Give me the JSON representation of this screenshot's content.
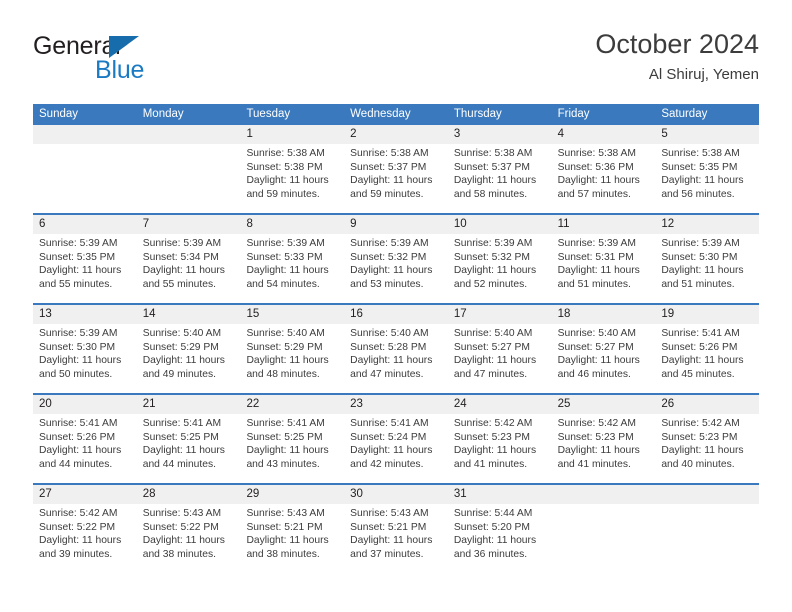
{
  "brand": {
    "name_top": "General",
    "name_bottom": "Blue",
    "accent_color": "#176dab",
    "blue_text_color": "#1b7ac4"
  },
  "header": {
    "title": "October 2024",
    "subtitle": "Al Shiruj, Yemen"
  },
  "theme": {
    "header_row_bg": "#3a79bd",
    "daynum_band_bg": "#f0f0f0",
    "row_divider": "#3a79bd",
    "text": "#3c3c3c"
  },
  "weekdays": [
    "Sunday",
    "Monday",
    "Tuesday",
    "Wednesday",
    "Thursday",
    "Friday",
    "Saturday"
  ],
  "weeks": [
    [
      {
        "day": "",
        "lines": []
      },
      {
        "day": "",
        "lines": []
      },
      {
        "day": "1",
        "lines": [
          "Sunrise: 5:38 AM",
          "Sunset: 5:38 PM",
          "Daylight: 11 hours",
          "and 59 minutes."
        ]
      },
      {
        "day": "2",
        "lines": [
          "Sunrise: 5:38 AM",
          "Sunset: 5:37 PM",
          "Daylight: 11 hours",
          "and 59 minutes."
        ]
      },
      {
        "day": "3",
        "lines": [
          "Sunrise: 5:38 AM",
          "Sunset: 5:37 PM",
          "Daylight: 11 hours",
          "and 58 minutes."
        ]
      },
      {
        "day": "4",
        "lines": [
          "Sunrise: 5:38 AM",
          "Sunset: 5:36 PM",
          "Daylight: 11 hours",
          "and 57 minutes."
        ]
      },
      {
        "day": "5",
        "lines": [
          "Sunrise: 5:38 AM",
          "Sunset: 5:35 PM",
          "Daylight: 11 hours",
          "and 56 minutes."
        ]
      }
    ],
    [
      {
        "day": "6",
        "lines": [
          "Sunrise: 5:39 AM",
          "Sunset: 5:35 PM",
          "Daylight: 11 hours",
          "and 55 minutes."
        ]
      },
      {
        "day": "7",
        "lines": [
          "Sunrise: 5:39 AM",
          "Sunset: 5:34 PM",
          "Daylight: 11 hours",
          "and 55 minutes."
        ]
      },
      {
        "day": "8",
        "lines": [
          "Sunrise: 5:39 AM",
          "Sunset: 5:33 PM",
          "Daylight: 11 hours",
          "and 54 minutes."
        ]
      },
      {
        "day": "9",
        "lines": [
          "Sunrise: 5:39 AM",
          "Sunset: 5:32 PM",
          "Daylight: 11 hours",
          "and 53 minutes."
        ]
      },
      {
        "day": "10",
        "lines": [
          "Sunrise: 5:39 AM",
          "Sunset: 5:32 PM",
          "Daylight: 11 hours",
          "and 52 minutes."
        ]
      },
      {
        "day": "11",
        "lines": [
          "Sunrise: 5:39 AM",
          "Sunset: 5:31 PM",
          "Daylight: 11 hours",
          "and 51 minutes."
        ]
      },
      {
        "day": "12",
        "lines": [
          "Sunrise: 5:39 AM",
          "Sunset: 5:30 PM",
          "Daylight: 11 hours",
          "and 51 minutes."
        ]
      }
    ],
    [
      {
        "day": "13",
        "lines": [
          "Sunrise: 5:39 AM",
          "Sunset: 5:30 PM",
          "Daylight: 11 hours",
          "and 50 minutes."
        ]
      },
      {
        "day": "14",
        "lines": [
          "Sunrise: 5:40 AM",
          "Sunset: 5:29 PM",
          "Daylight: 11 hours",
          "and 49 minutes."
        ]
      },
      {
        "day": "15",
        "lines": [
          "Sunrise: 5:40 AM",
          "Sunset: 5:29 PM",
          "Daylight: 11 hours",
          "and 48 minutes."
        ]
      },
      {
        "day": "16",
        "lines": [
          "Sunrise: 5:40 AM",
          "Sunset: 5:28 PM",
          "Daylight: 11 hours",
          "and 47 minutes."
        ]
      },
      {
        "day": "17",
        "lines": [
          "Sunrise: 5:40 AM",
          "Sunset: 5:27 PM",
          "Daylight: 11 hours",
          "and 47 minutes."
        ]
      },
      {
        "day": "18",
        "lines": [
          "Sunrise: 5:40 AM",
          "Sunset: 5:27 PM",
          "Daylight: 11 hours",
          "and 46 minutes."
        ]
      },
      {
        "day": "19",
        "lines": [
          "Sunrise: 5:41 AM",
          "Sunset: 5:26 PM",
          "Daylight: 11 hours",
          "and 45 minutes."
        ]
      }
    ],
    [
      {
        "day": "20",
        "lines": [
          "Sunrise: 5:41 AM",
          "Sunset: 5:26 PM",
          "Daylight: 11 hours",
          "and 44 minutes."
        ]
      },
      {
        "day": "21",
        "lines": [
          "Sunrise: 5:41 AM",
          "Sunset: 5:25 PM",
          "Daylight: 11 hours",
          "and 44 minutes."
        ]
      },
      {
        "day": "22",
        "lines": [
          "Sunrise: 5:41 AM",
          "Sunset: 5:25 PM",
          "Daylight: 11 hours",
          "and 43 minutes."
        ]
      },
      {
        "day": "23",
        "lines": [
          "Sunrise: 5:41 AM",
          "Sunset: 5:24 PM",
          "Daylight: 11 hours",
          "and 42 minutes."
        ]
      },
      {
        "day": "24",
        "lines": [
          "Sunrise: 5:42 AM",
          "Sunset: 5:23 PM",
          "Daylight: 11 hours",
          "and 41 minutes."
        ]
      },
      {
        "day": "25",
        "lines": [
          "Sunrise: 5:42 AM",
          "Sunset: 5:23 PM",
          "Daylight: 11 hours",
          "and 41 minutes."
        ]
      },
      {
        "day": "26",
        "lines": [
          "Sunrise: 5:42 AM",
          "Sunset: 5:23 PM",
          "Daylight: 11 hours",
          "and 40 minutes."
        ]
      }
    ],
    [
      {
        "day": "27",
        "lines": [
          "Sunrise: 5:42 AM",
          "Sunset: 5:22 PM",
          "Daylight: 11 hours",
          "and 39 minutes."
        ]
      },
      {
        "day": "28",
        "lines": [
          "Sunrise: 5:43 AM",
          "Sunset: 5:22 PM",
          "Daylight: 11 hours",
          "and 38 minutes."
        ]
      },
      {
        "day": "29",
        "lines": [
          "Sunrise: 5:43 AM",
          "Sunset: 5:21 PM",
          "Daylight: 11 hours",
          "and 38 minutes."
        ]
      },
      {
        "day": "30",
        "lines": [
          "Sunrise: 5:43 AM",
          "Sunset: 5:21 PM",
          "Daylight: 11 hours",
          "and 37 minutes."
        ]
      },
      {
        "day": "31",
        "lines": [
          "Sunrise: 5:44 AM",
          "Sunset: 5:20 PM",
          "Daylight: 11 hours",
          "and 36 minutes."
        ]
      },
      {
        "day": "",
        "lines": []
      },
      {
        "day": "",
        "lines": []
      }
    ]
  ]
}
